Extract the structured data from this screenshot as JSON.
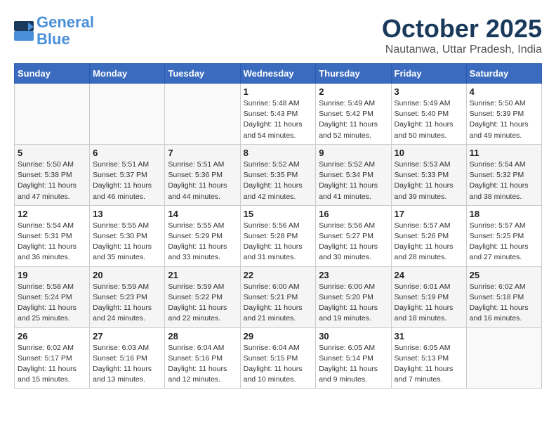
{
  "logo": {
    "line1": "General",
    "line2": "Blue"
  },
  "title": "October 2025",
  "subtitle": "Nautanwa, Uttar Pradesh, India",
  "days_of_week": [
    "Sunday",
    "Monday",
    "Tuesday",
    "Wednesday",
    "Thursday",
    "Friday",
    "Saturday"
  ],
  "weeks": [
    [
      {
        "day": "",
        "info": ""
      },
      {
        "day": "",
        "info": ""
      },
      {
        "day": "",
        "info": ""
      },
      {
        "day": "1",
        "info": "Sunrise: 5:48 AM\nSunset: 5:43 PM\nDaylight: 11 hours\nand 54 minutes."
      },
      {
        "day": "2",
        "info": "Sunrise: 5:49 AM\nSunset: 5:42 PM\nDaylight: 11 hours\nand 52 minutes."
      },
      {
        "day": "3",
        "info": "Sunrise: 5:49 AM\nSunset: 5:40 PM\nDaylight: 11 hours\nand 50 minutes."
      },
      {
        "day": "4",
        "info": "Sunrise: 5:50 AM\nSunset: 5:39 PM\nDaylight: 11 hours\nand 49 minutes."
      }
    ],
    [
      {
        "day": "5",
        "info": "Sunrise: 5:50 AM\nSunset: 5:38 PM\nDaylight: 11 hours\nand 47 minutes."
      },
      {
        "day": "6",
        "info": "Sunrise: 5:51 AM\nSunset: 5:37 PM\nDaylight: 11 hours\nand 46 minutes."
      },
      {
        "day": "7",
        "info": "Sunrise: 5:51 AM\nSunset: 5:36 PM\nDaylight: 11 hours\nand 44 minutes."
      },
      {
        "day": "8",
        "info": "Sunrise: 5:52 AM\nSunset: 5:35 PM\nDaylight: 11 hours\nand 42 minutes."
      },
      {
        "day": "9",
        "info": "Sunrise: 5:52 AM\nSunset: 5:34 PM\nDaylight: 11 hours\nand 41 minutes."
      },
      {
        "day": "10",
        "info": "Sunrise: 5:53 AM\nSunset: 5:33 PM\nDaylight: 11 hours\nand 39 minutes."
      },
      {
        "day": "11",
        "info": "Sunrise: 5:54 AM\nSunset: 5:32 PM\nDaylight: 11 hours\nand 38 minutes."
      }
    ],
    [
      {
        "day": "12",
        "info": "Sunrise: 5:54 AM\nSunset: 5:31 PM\nDaylight: 11 hours\nand 36 minutes."
      },
      {
        "day": "13",
        "info": "Sunrise: 5:55 AM\nSunset: 5:30 PM\nDaylight: 11 hours\nand 35 minutes."
      },
      {
        "day": "14",
        "info": "Sunrise: 5:55 AM\nSunset: 5:29 PM\nDaylight: 11 hours\nand 33 minutes."
      },
      {
        "day": "15",
        "info": "Sunrise: 5:56 AM\nSunset: 5:28 PM\nDaylight: 11 hours\nand 31 minutes."
      },
      {
        "day": "16",
        "info": "Sunrise: 5:56 AM\nSunset: 5:27 PM\nDaylight: 11 hours\nand 30 minutes."
      },
      {
        "day": "17",
        "info": "Sunrise: 5:57 AM\nSunset: 5:26 PM\nDaylight: 11 hours\nand 28 minutes."
      },
      {
        "day": "18",
        "info": "Sunrise: 5:57 AM\nSunset: 5:25 PM\nDaylight: 11 hours\nand 27 minutes."
      }
    ],
    [
      {
        "day": "19",
        "info": "Sunrise: 5:58 AM\nSunset: 5:24 PM\nDaylight: 11 hours\nand 25 minutes."
      },
      {
        "day": "20",
        "info": "Sunrise: 5:59 AM\nSunset: 5:23 PM\nDaylight: 11 hours\nand 24 minutes."
      },
      {
        "day": "21",
        "info": "Sunrise: 5:59 AM\nSunset: 5:22 PM\nDaylight: 11 hours\nand 22 minutes."
      },
      {
        "day": "22",
        "info": "Sunrise: 6:00 AM\nSunset: 5:21 PM\nDaylight: 11 hours\nand 21 minutes."
      },
      {
        "day": "23",
        "info": "Sunrise: 6:00 AM\nSunset: 5:20 PM\nDaylight: 11 hours\nand 19 minutes."
      },
      {
        "day": "24",
        "info": "Sunrise: 6:01 AM\nSunset: 5:19 PM\nDaylight: 11 hours\nand 18 minutes."
      },
      {
        "day": "25",
        "info": "Sunrise: 6:02 AM\nSunset: 5:18 PM\nDaylight: 11 hours\nand 16 minutes."
      }
    ],
    [
      {
        "day": "26",
        "info": "Sunrise: 6:02 AM\nSunset: 5:17 PM\nDaylight: 11 hours\nand 15 minutes."
      },
      {
        "day": "27",
        "info": "Sunrise: 6:03 AM\nSunset: 5:16 PM\nDaylight: 11 hours\nand 13 minutes."
      },
      {
        "day": "28",
        "info": "Sunrise: 6:04 AM\nSunset: 5:16 PM\nDaylight: 11 hours\nand 12 minutes."
      },
      {
        "day": "29",
        "info": "Sunrise: 6:04 AM\nSunset: 5:15 PM\nDaylight: 11 hours\nand 10 minutes."
      },
      {
        "day": "30",
        "info": "Sunrise: 6:05 AM\nSunset: 5:14 PM\nDaylight: 11 hours\nand 9 minutes."
      },
      {
        "day": "31",
        "info": "Sunrise: 6:05 AM\nSunset: 5:13 PM\nDaylight: 11 hours\nand 7 minutes."
      },
      {
        "day": "",
        "info": ""
      }
    ]
  ]
}
